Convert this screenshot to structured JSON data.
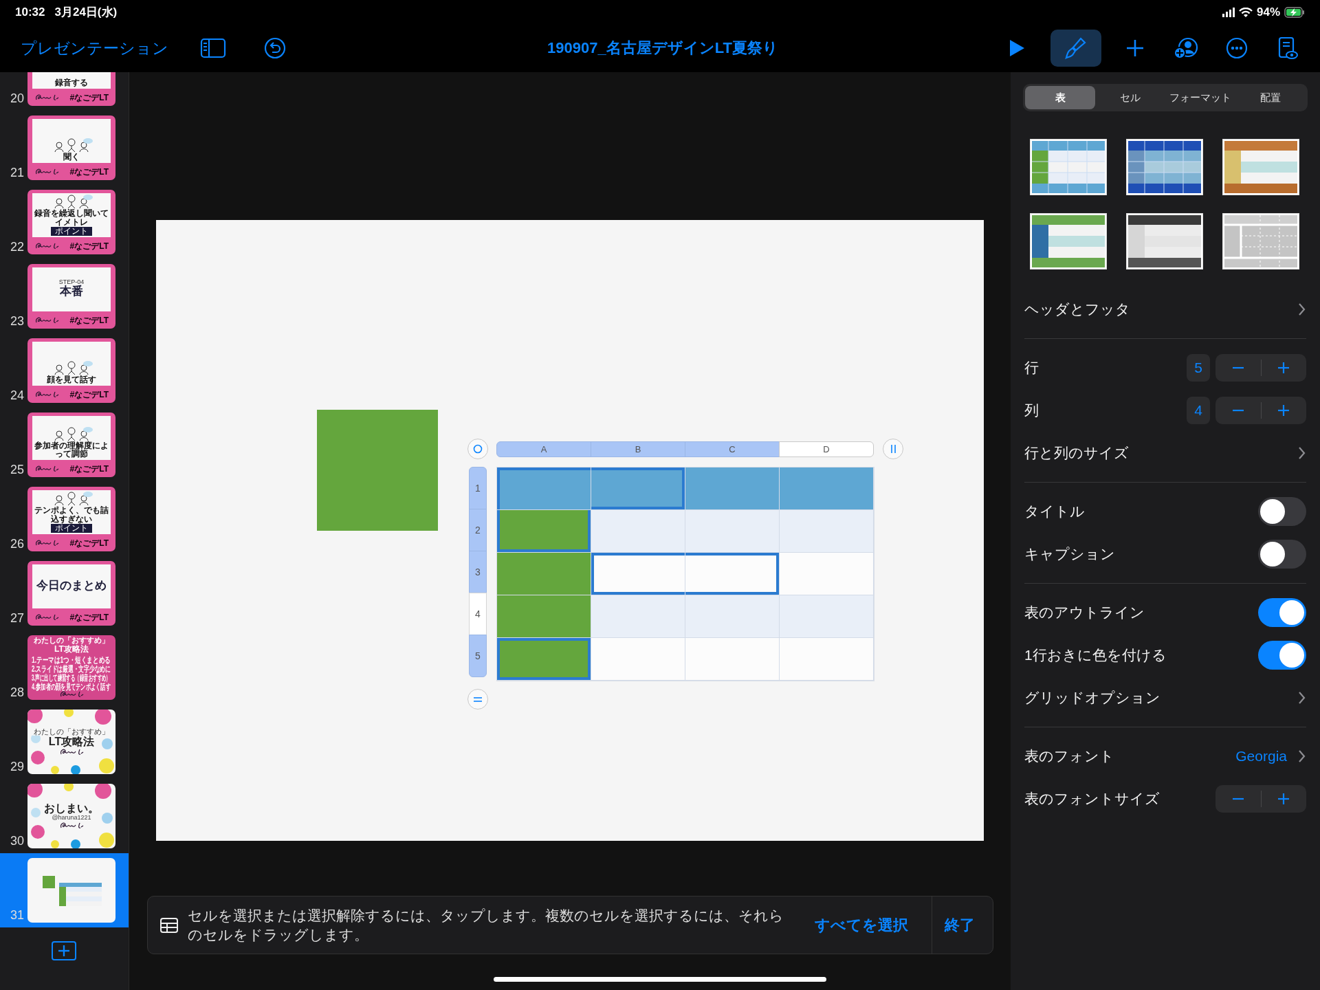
{
  "status_bar": {
    "time": "10:32",
    "date": "3月24日(水)",
    "battery": "94%"
  },
  "toolbar": {
    "back": "プレゼンテーション",
    "title": "190907_名古屋デザインLT夏祭り",
    "left_tools": [
      {
        "kind": "sidebar"
      },
      {
        "kind": "undo"
      }
    ],
    "right_tools": [
      {
        "kind": "play",
        "selected": false
      },
      {
        "kind": "format",
        "selected": true
      },
      {
        "kind": "add",
        "selected": false
      },
      {
        "kind": "collaborate",
        "selected": false
      },
      {
        "kind": "more",
        "selected": false
      },
      {
        "kind": "presenter",
        "selected": false
      }
    ]
  },
  "slides": [
    {
      "number": "20",
      "kind": "caption",
      "selected": false,
      "illustration": false,
      "title": "録音する",
      "footer": "#なごデLT"
    },
    {
      "number": "21",
      "kind": "caption",
      "selected": false,
      "illustration": true,
      "title": "聞く",
      "footer": "#なごデLT"
    },
    {
      "number": "22",
      "kind": "caption",
      "selected": false,
      "illustration": true,
      "title": "録音を繰返し聞いてイメトレ",
      "badge": "ポイント",
      "footer": "#なごデLT"
    },
    {
      "number": "23",
      "kind": "heading",
      "selected": false,
      "eyebrow": "STEP-04",
      "title": "本番",
      "footer": "#なごデLT"
    },
    {
      "number": "24",
      "kind": "caption",
      "selected": false,
      "illustration": true,
      "title": "顔を見て話す",
      "footer": "#なごデLT"
    },
    {
      "number": "25",
      "kind": "caption",
      "selected": false,
      "illustration": true,
      "title": "参加者の理解度によって調節",
      "footer": "#なごデLT"
    },
    {
      "number": "26",
      "kind": "caption",
      "selected": false,
      "illustration": true,
      "title": "テンポよく、でも詰込すぎない",
      "badge": "ポイント",
      "footer": "#なごデLT"
    },
    {
      "number": "27",
      "kind": "heading",
      "selected": false,
      "title": "今日のまとめ",
      "footer": "#なごデLT"
    },
    {
      "number": "28",
      "kind": "list",
      "selected": false,
      "eyebrow": "わたしの「おすすめ」",
      "title": "LT攻略法",
      "items": [
        "1.テーマは1つ・短くまとめる",
        "2.スライドは厳選・文字少なめに",
        "3.声に出して練習する（録音おすすめ）",
        "4.参加者の顔を見てテンポよく話す"
      ]
    },
    {
      "number": "29",
      "kind": "dots",
      "selected": false,
      "eyebrow": "わたしの「おすすめ」",
      "title": "LT攻略法"
    },
    {
      "number": "30",
      "kind": "dots",
      "selected": false,
      "title": "おしまい。",
      "subtitle": "@haruna1221"
    },
    {
      "number": "31",
      "kind": "table",
      "selected": true
    }
  ],
  "table": {
    "columns": [
      {
        "label": "A",
        "kind": "header",
        "selected": true
      },
      {
        "label": "B",
        "kind": "body",
        "selected": true
      },
      {
        "label": "C",
        "kind": "body",
        "selected": true
      },
      {
        "label": "D",
        "kind": "body",
        "selected": false
      }
    ],
    "rows": [
      {
        "label": "1",
        "kind": "header",
        "selected": true,
        "cells": [
          {
            "selected": true
          },
          {
            "selected": true
          },
          {
            "selected": false
          },
          {
            "selected": false
          }
        ]
      },
      {
        "label": "2",
        "kind": "body",
        "selected": true,
        "cells": [
          {
            "selected": true
          },
          {
            "selected": false
          },
          {
            "selected": false
          },
          {
            "selected": false
          }
        ]
      },
      {
        "label": "3",
        "kind": "body",
        "selected": true,
        "cells": [
          {
            "selected": false
          },
          {
            "selected": true
          },
          {
            "selected": true
          },
          {
            "selected": false
          }
        ]
      },
      {
        "label": "4",
        "kind": "body",
        "selected": false,
        "cells": [
          {
            "selected": false
          },
          {
            "selected": false
          },
          {
            "selected": false
          },
          {
            "selected": false
          }
        ]
      },
      {
        "label": "5",
        "kind": "body",
        "selected": true,
        "cells": [
          {
            "selected": true
          },
          {
            "selected": false
          },
          {
            "selected": false
          },
          {
            "selected": false
          }
        ]
      }
    ]
  },
  "hint": {
    "text": "セルを選択または選択解除するには、タップします。複数のセルを選択するには、それらのセルをドラッグします。",
    "actions": [
      "すべてを選択",
      "終了"
    ]
  },
  "inspector": {
    "tabs": [
      {
        "label": "表",
        "selected": true
      },
      {
        "label": "セル",
        "selected": false
      },
      {
        "label": "フォーマット",
        "selected": false
      },
      {
        "label": "配置",
        "selected": false
      }
    ],
    "table_styles": [
      {
        "kind": "blue"
      },
      {
        "kind": "navy"
      },
      {
        "kind": "orange"
      },
      {
        "kind": "green"
      },
      {
        "kind": "gray"
      },
      {
        "kind": "silver"
      }
    ],
    "groups": [
      [
        {
          "kind": "link",
          "label": "ヘッダとフッタ"
        }
      ],
      [
        {
          "kind": "stepper",
          "label": "行",
          "value": "5"
        },
        {
          "kind": "stepper",
          "label": "列",
          "value": "4"
        },
        {
          "kind": "link",
          "label": "行と列のサイズ"
        }
      ],
      [
        {
          "kind": "toggle",
          "label": "タイトル",
          "on": false
        },
        {
          "kind": "toggle",
          "label": "キャプション",
          "on": false
        }
      ],
      [
        {
          "kind": "toggle",
          "label": "表のアウトライン",
          "on": true
        },
        {
          "kind": "toggle",
          "label": "1行おきに色を付ける",
          "on": true
        },
        {
          "kind": "link",
          "label": "グリッドオプション"
        }
      ],
      [
        {
          "kind": "link",
          "label": "表のフォント",
          "value": "Georgia"
        },
        {
          "kind": "stepper",
          "label": "表のフォントサイズ"
        }
      ]
    ]
  }
}
